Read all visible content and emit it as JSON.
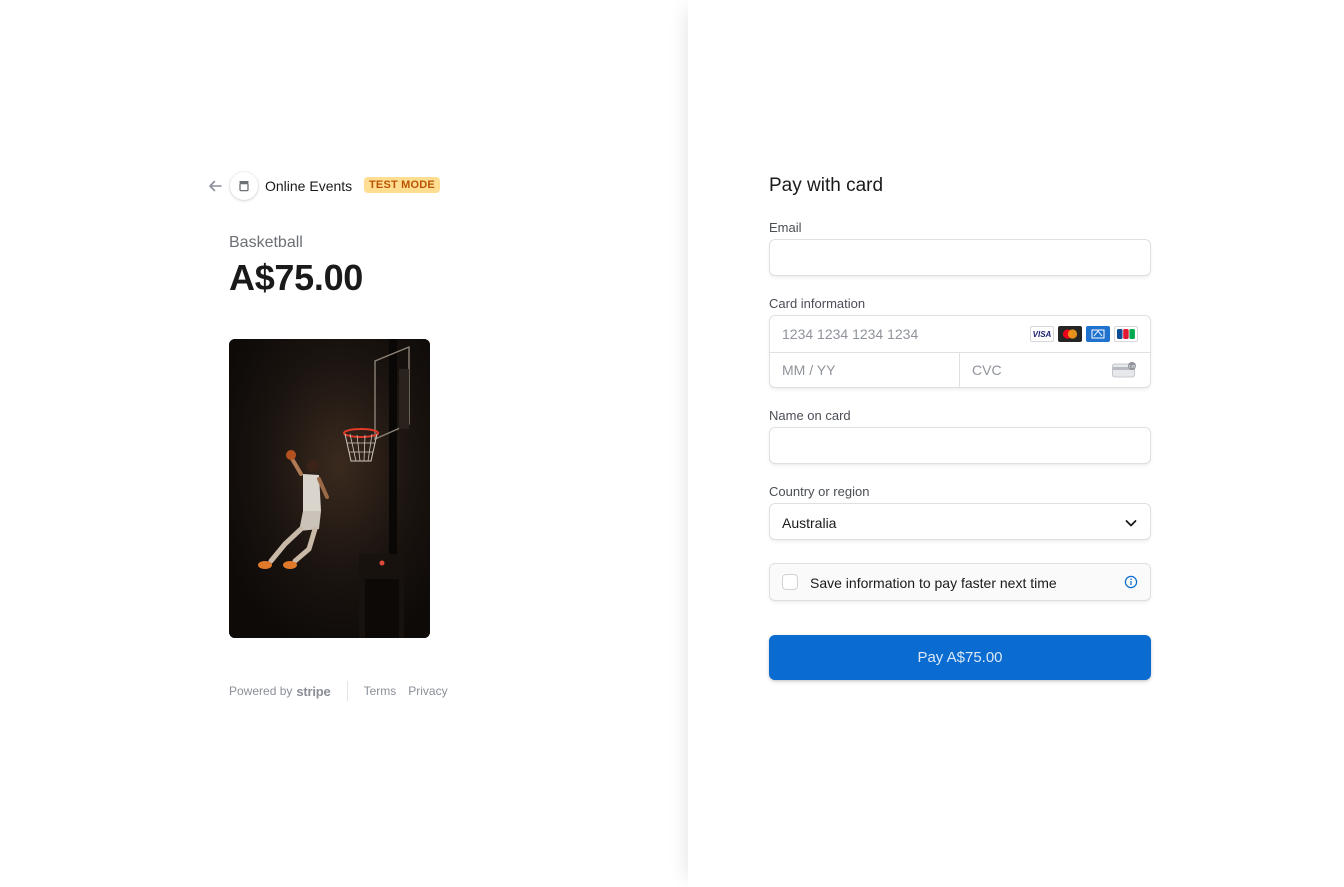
{
  "header": {
    "merchant_name": "Online Events",
    "test_badge": "TEST MODE"
  },
  "product": {
    "name": "Basketball",
    "price": "A$75.00"
  },
  "footer": {
    "powered_by": "Powered by",
    "brand": "stripe",
    "terms": "Terms",
    "privacy": "Privacy"
  },
  "form": {
    "title": "Pay with card",
    "email_label": "Email",
    "email_value": "",
    "card_label": "Card information",
    "card_number_placeholder": "1234 1234 1234 1234",
    "expiry_placeholder": "MM / YY",
    "cvc_placeholder": "CVC",
    "card_brands": [
      "VISA",
      "mastercard",
      "amex",
      "jcb"
    ],
    "name_label": "Name on card",
    "name_value": "",
    "country_label": "Country or region",
    "country_value": "Australia",
    "save_info_label": "Save information to pay faster next time",
    "pay_button": "Pay A$75.00"
  },
  "colors": {
    "accent": "#0a6bd1",
    "badge_bg": "#ffde92",
    "badge_text": "#bb5504"
  },
  "icons": {
    "back": "arrow-left-icon",
    "merchant": "store-icon",
    "cvc": "card-back-icon",
    "country": "chevron-down-icon",
    "info": "info-icon"
  }
}
